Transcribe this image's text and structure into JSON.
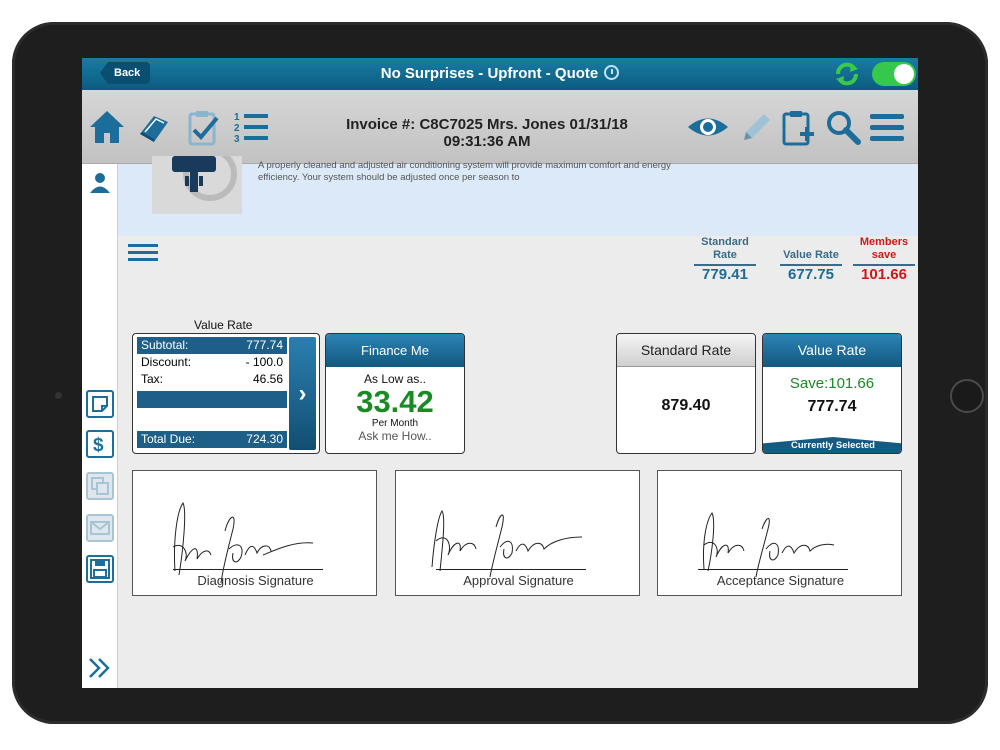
{
  "titlebar": {
    "back_label": "Back",
    "title": "No Surprises - Upfront - Quote"
  },
  "invoice": {
    "line1": "Invoice #: C8C7025   Mrs. Jones  01/31/18",
    "line2": "09:31:36 AM"
  },
  "banner": {
    "description": "A properly cleaned and adjusted air conditioning system will provide maximum comfort and energy efficiency. Your system should be adjusted once per season to"
  },
  "rates_summary": [
    {
      "label": "Standard Rate",
      "value": "779.41"
    },
    {
      "label": "Value Rate",
      "value": "677.75"
    },
    {
      "label": "Members save",
      "value": "101.66"
    }
  ],
  "value_rate_box": {
    "caption": "Value Rate",
    "subtotal_label": "Subtotal:",
    "subtotal_value": "777.74",
    "discount_label": "Discount:",
    "discount_value": "- 100.0",
    "tax_label": "Tax:",
    "tax_value": "46.56",
    "total_label": "Total Due:",
    "total_value": "724.30",
    "arrow": "›"
  },
  "finance": {
    "header": "Finance Me",
    "low": "As Low as..",
    "amount": "33.42",
    "per": "Per Month",
    "ask": "Ask me How.."
  },
  "standard_card": {
    "header": "Standard Rate",
    "value": "879.40"
  },
  "value_card": {
    "header": "Value Rate",
    "save": "Save:101.66",
    "value": "777.74",
    "selected": "Currently Selected"
  },
  "signatures": [
    {
      "caption": "Diagnosis Signature"
    },
    {
      "caption": "Approval Signature"
    },
    {
      "caption": "Acceptance Signature"
    }
  ],
  "colors": {
    "accent": "#1d5f86",
    "green": "#1a8a24",
    "red": "#d01818"
  }
}
